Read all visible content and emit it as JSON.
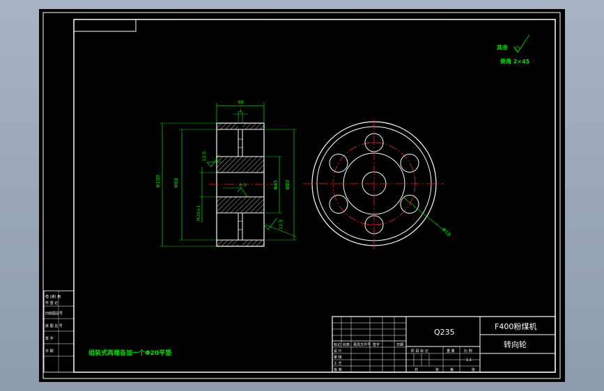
{
  "colors": {
    "background": "#000000",
    "outline": "#ffffff",
    "dimension": "#00e000",
    "centerline": "#ff2020"
  },
  "dims": {
    "width_40": "40",
    "width_4": "4",
    "d100": "Φ100",
    "d60": "Φ60",
    "d45": "Φ45",
    "d80": "Φ80",
    "holes": "M20×1",
    "r12_5_top": "12.5",
    "r12_5_bot": "12.5",
    "rough_6_3": "6.3",
    "phi18": "Φ18"
  },
  "roughness": {
    "rest_label": "其余",
    "chamfer": "倒角  2×45"
  },
  "note": "组装式两端各加一个Φ20平垫",
  "title_block": {
    "material": "Q235",
    "machine": "F400粉煤机",
    "part_name": "转向轮",
    "scale": "1:1",
    "rev_headers": [
      "标记",
      "处数",
      "更改文件号",
      "签字",
      "日期"
    ],
    "sign_rows": [
      "设 计",
      "审 核",
      "工 艺"
    ],
    "stage_headers": [
      "阶 段 标 记",
      "重 量",
      "比 例"
    ],
    "sheet": [
      "共",
      "张",
      "第",
      "张"
    ],
    "approve": "批 准"
  },
  "left_strip": {
    "items": [
      "借 (通) 用",
      "件 登 记",
      "旧底图总号",
      "底 图 总 号",
      "签 字",
      "日 期"
    ]
  }
}
